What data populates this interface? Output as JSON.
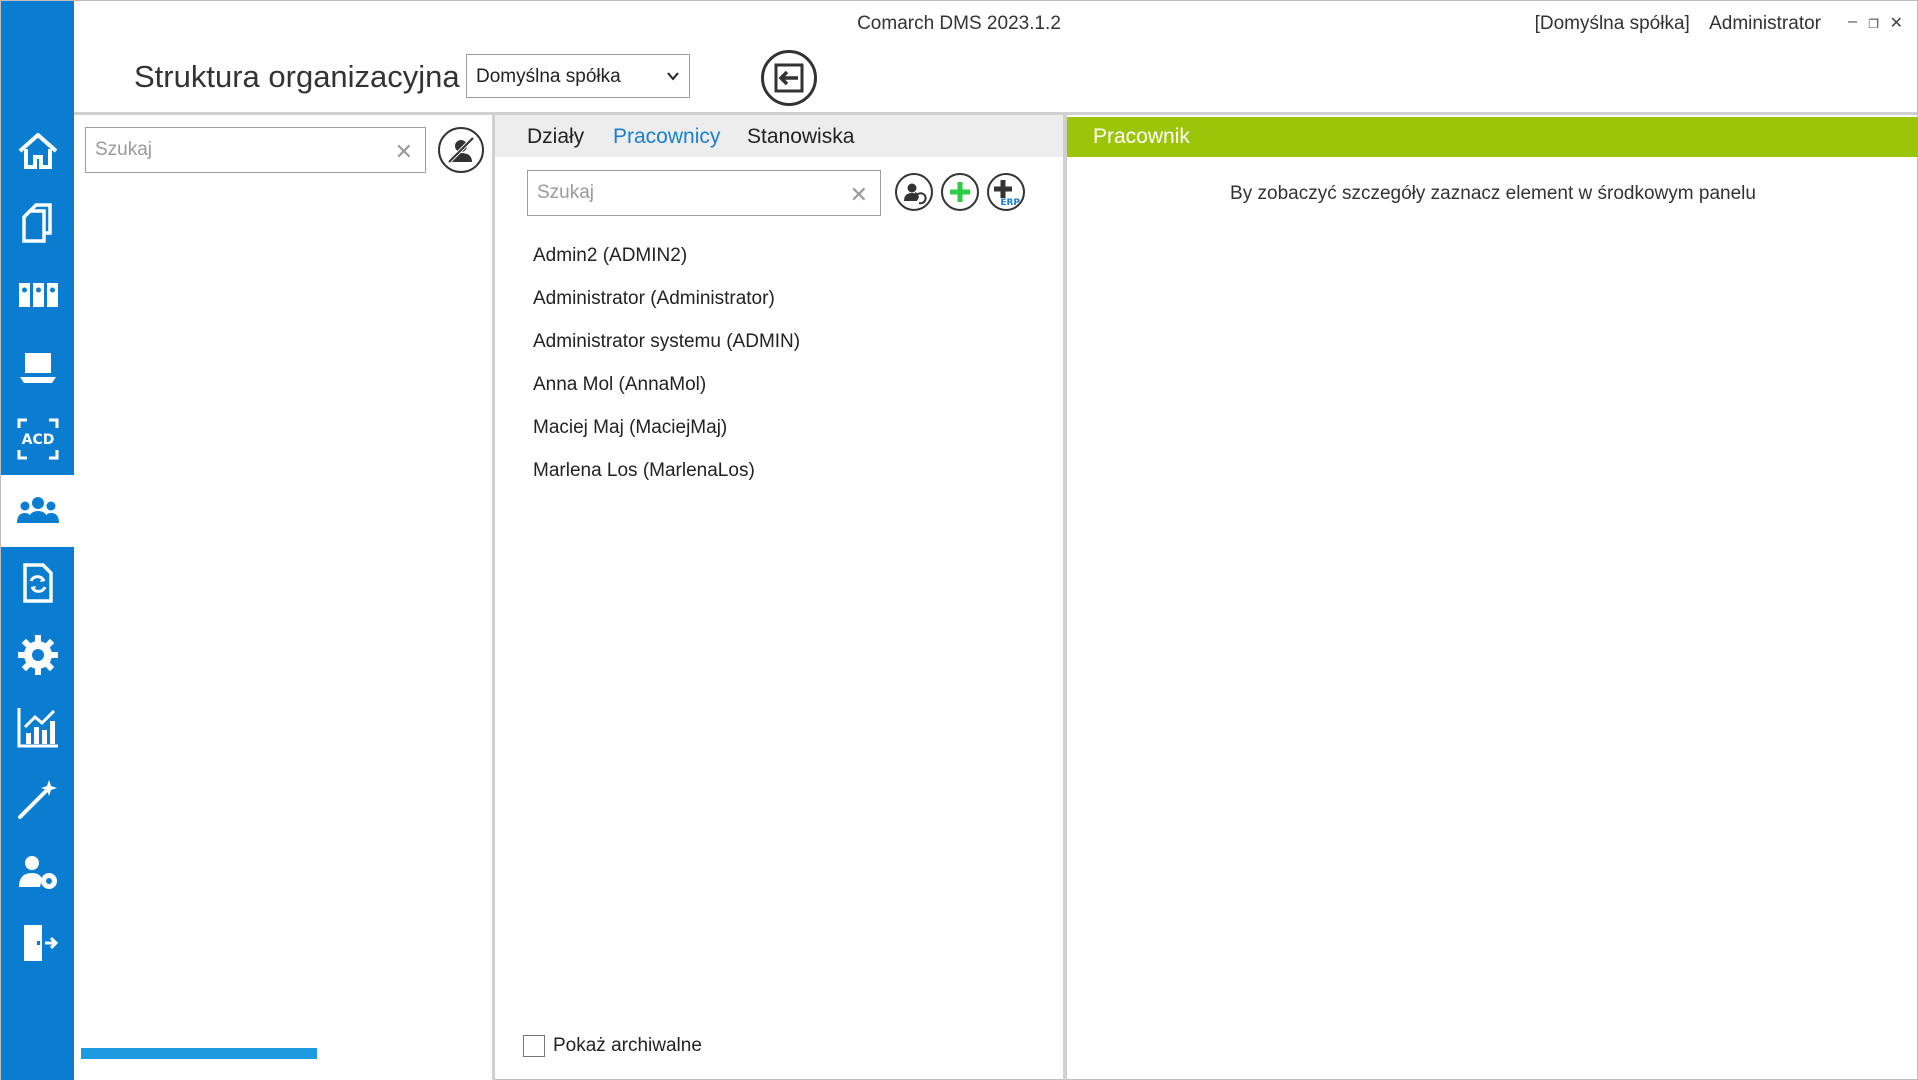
{
  "window": {
    "title": "Comarch DMS 2023.1.2",
    "company": "[Domyślna spółka]",
    "user": "Administrator",
    "controls": {
      "minimize": "–",
      "restore": "❐",
      "close": "✕"
    }
  },
  "sidebar": {
    "items": [
      {
        "icon": "home-icon"
      },
      {
        "icon": "documents-icon"
      },
      {
        "icon": "binders-icon"
      },
      {
        "icon": "laptop-icon"
      },
      {
        "icon": "acd-icon"
      },
      {
        "icon": "users-icon",
        "active": true
      },
      {
        "icon": "workflow-document-icon"
      },
      {
        "icon": "gear-icon"
      },
      {
        "icon": "reports-chart-icon"
      },
      {
        "icon": "magic-wand-icon"
      },
      {
        "icon": "user-settings-icon"
      },
      {
        "icon": "logout-door-icon"
      }
    ]
  },
  "header": {
    "page_title": "Struktura organizacyjna",
    "company_select": {
      "value": "Domyślna spółka"
    }
  },
  "left_panel": {
    "search": {
      "placeholder": "Szukaj",
      "value": ""
    },
    "progress": 1.0
  },
  "middle_panel": {
    "tabs": [
      {
        "label": "Działy",
        "active": false
      },
      {
        "label": "Pracownicy",
        "active": true
      },
      {
        "label": "Stanowiska",
        "active": false
      }
    ],
    "search": {
      "placeholder": "Szukaj",
      "value": ""
    },
    "employees": [
      "Admin2 (ADMIN2)",
      "Administrator (Administrator)",
      "Administrator systemu (ADMIN)",
      "Anna Mol (AnnaMol)",
      "Maciej Maj (MaciejMaj)",
      "Marlena Los (MarlenaLos)"
    ],
    "show_archived": {
      "label": "Pokaż archiwalne",
      "checked": false
    }
  },
  "right_panel": {
    "header": "Pracownik",
    "message": "By zobaczyć szczegóły zaznacz element w środkowym panelu",
    "header_color": "#9cc408"
  },
  "colors": {
    "sidebar": "#0b7dd1",
    "active_tab": "#1b7fd0",
    "add_button": "#2ecc40"
  }
}
